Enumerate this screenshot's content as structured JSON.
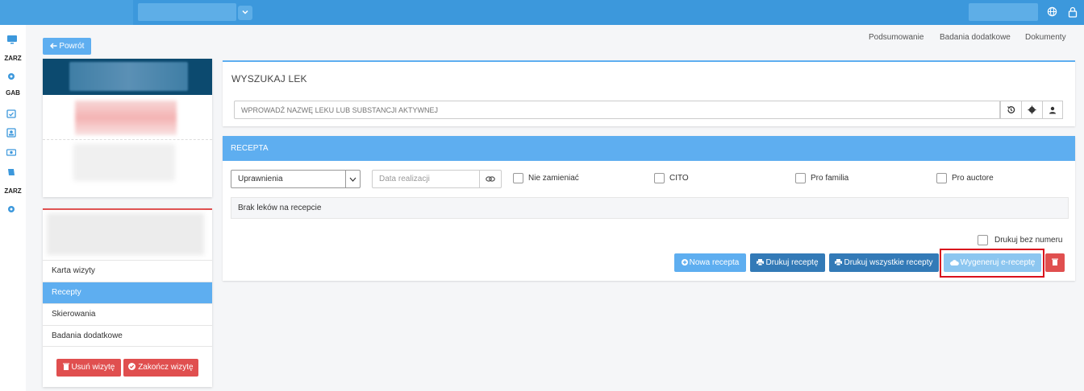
{
  "topbar": {
    "lang_icon": "globe-icon",
    "lock_icon": "lock-icon"
  },
  "mininav": {
    "label_zarz_1": "ZARZ",
    "label_gab": "GAB",
    "label_zarz_2": "ZARZ"
  },
  "back_label": "Powrót",
  "toplinks": {
    "summary": "Podsumowanie",
    "extra_tests": "Badania dodatkowe",
    "documents": "Dokumenty"
  },
  "visit_menu": {
    "items": [
      {
        "label": "Karta wizyty",
        "active": false
      },
      {
        "label": "Recepty",
        "active": true
      },
      {
        "label": "Skierowania",
        "active": false
      },
      {
        "label": "Badania dodatkowe",
        "active": false
      }
    ],
    "delete_label": "Usuń wizytę",
    "finish_label": "Zakończ wizytę"
  },
  "search": {
    "title": "WYSZUKAJ LEK",
    "placeholder": "WPROWADŹ NAZWĘ LEKU LUB SUBSTANCJI AKTYWNEJ",
    "icons": [
      "history-icon",
      "gear-icon",
      "user-icon"
    ]
  },
  "recipe": {
    "title": "RECEPTA",
    "permissions_value": "Uprawnienia",
    "date_placeholder": "Data realizacji",
    "checkboxes": {
      "no_replace": "Nie zamieniać",
      "cito": "CITO",
      "pro_familia": "Pro familia",
      "pro_auctore": "Pro auctore"
    },
    "empty_text": "Brak leków na recepcie",
    "print_no_number": "Drukuj bez numeru",
    "buttons": {
      "new": "Nowa recepta",
      "print": "Drukuj receptę",
      "print_all": "Drukuj wszystkie recepty",
      "generate": "Wygeneruj e-receptę"
    }
  },
  "colors": {
    "topbar": "#3c98dc",
    "accent": "#5eaef0",
    "danger": "#e04f4f",
    "primary_dark": "#337ab7",
    "highlight": "#d9101d"
  }
}
